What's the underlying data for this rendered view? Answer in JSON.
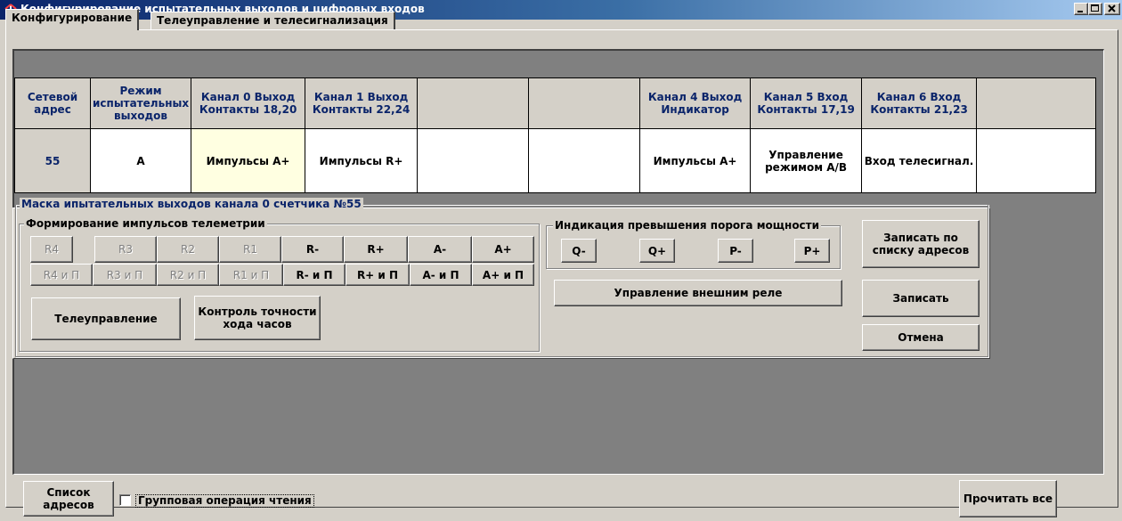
{
  "window": {
    "title": "Конфигурирование испытательных выходов и цифровых входов"
  },
  "tabs": [
    "Конфигурирование",
    "Телеуправление и телесигнализация"
  ],
  "grid": {
    "headers": [
      "Сетевой адрес",
      "Режим испытательных выходов",
      "Канал 0 Выход Контакты 18,20",
      "Канал 1 Выход Контакты 22,24",
      "",
      "",
      "Канал 4 Выход Индикатор",
      "Канал 5 Вход Контакты 17,19",
      "Канал 6 Вход Контакты 21,23",
      ""
    ],
    "values": [
      "55",
      "A",
      "Импульсы А+",
      "Импульсы R+",
      "",
      "",
      "Импульсы А+",
      "Управление режимом А/В",
      "Вход телесигнал.",
      ""
    ]
  },
  "mask": {
    "title": "Маска ипытательных выходов канала 0 счетчика №55",
    "telemetry": {
      "title": "Формирование импульсов телеметрии",
      "row1": [
        "R4",
        "R3",
        "R2",
        "R1",
        "R-",
        "R+",
        "A-",
        "A+"
      ],
      "row2": [
        "R4 и П",
        "R3 и П",
        "R2 и П",
        "R1 и П",
        "R- и П",
        "R+ и П",
        "A- и П",
        "A+ и П"
      ],
      "telecontrol_label": "Телеуправление",
      "clock_label": "Контроль точности хода часов"
    },
    "power": {
      "title": "Индикация превышения порога мощности",
      "buttons": [
        "Q-",
        "Q+",
        "P-",
        "P+"
      ],
      "relay_label": "Управление внешним реле"
    },
    "write_list_label": "Записать по списку адресов",
    "write_label": "Записать",
    "cancel_label": "Отмена"
  },
  "footer": {
    "address_list_label": "Список адресов",
    "group_read_label": "Групповая операция чтения",
    "group_read_checked": false,
    "read_all_label": "Прочитать все"
  },
  "colors": {
    "face": "#d4d0c8",
    "dark_area": "#808080",
    "header_text": "#0a246a",
    "selected_cell": "#ffffe1"
  }
}
